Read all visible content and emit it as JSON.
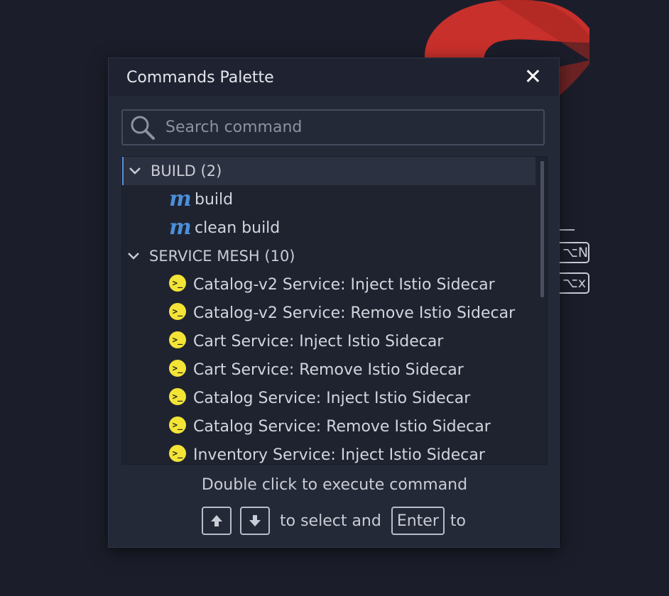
{
  "background": {
    "shortcut_keys": [
      "⌥N",
      "⌥x"
    ],
    "logo_color": "#c8302c"
  },
  "dialog": {
    "title": "Commands Palette",
    "close_icon": "close-icon",
    "search": {
      "placeholder": "Search command",
      "value": ""
    },
    "groups": [
      {
        "label": "BUILD (2)",
        "expanded": true,
        "items": [
          {
            "icon": "maven-icon",
            "label": "build"
          },
          {
            "icon": "maven-icon",
            "label": "clean build"
          }
        ]
      },
      {
        "label": "SERVICE MESH (10)",
        "expanded": true,
        "items": [
          {
            "icon": "terminal-icon",
            "label": "Catalog-v2 Service: Inject Istio Sidecar"
          },
          {
            "icon": "terminal-icon",
            "label": "Catalog-v2 Service: Remove Istio Sidecar"
          },
          {
            "icon": "terminal-icon",
            "label": "Cart Service: Inject Istio Sidecar"
          },
          {
            "icon": "terminal-icon",
            "label": "Cart Service: Remove Istio Sidecar"
          },
          {
            "icon": "terminal-icon",
            "label": "Catalog Service: Inject Istio Sidecar"
          },
          {
            "icon": "terminal-icon",
            "label": "Catalog Service: Remove Istio Sidecar"
          },
          {
            "icon": "terminal-icon",
            "label": "Inventory Service: Inject Istio Sidecar"
          }
        ]
      }
    ],
    "footer": {
      "hint": "Double click to execute command",
      "select_text": "to select and",
      "enter_key": "Enter",
      "to_text": "to"
    },
    "colors": {
      "accent": "#5a8fd6",
      "terminal_icon": "#f3e436",
      "maven_icon": "#4a8fd9"
    }
  }
}
